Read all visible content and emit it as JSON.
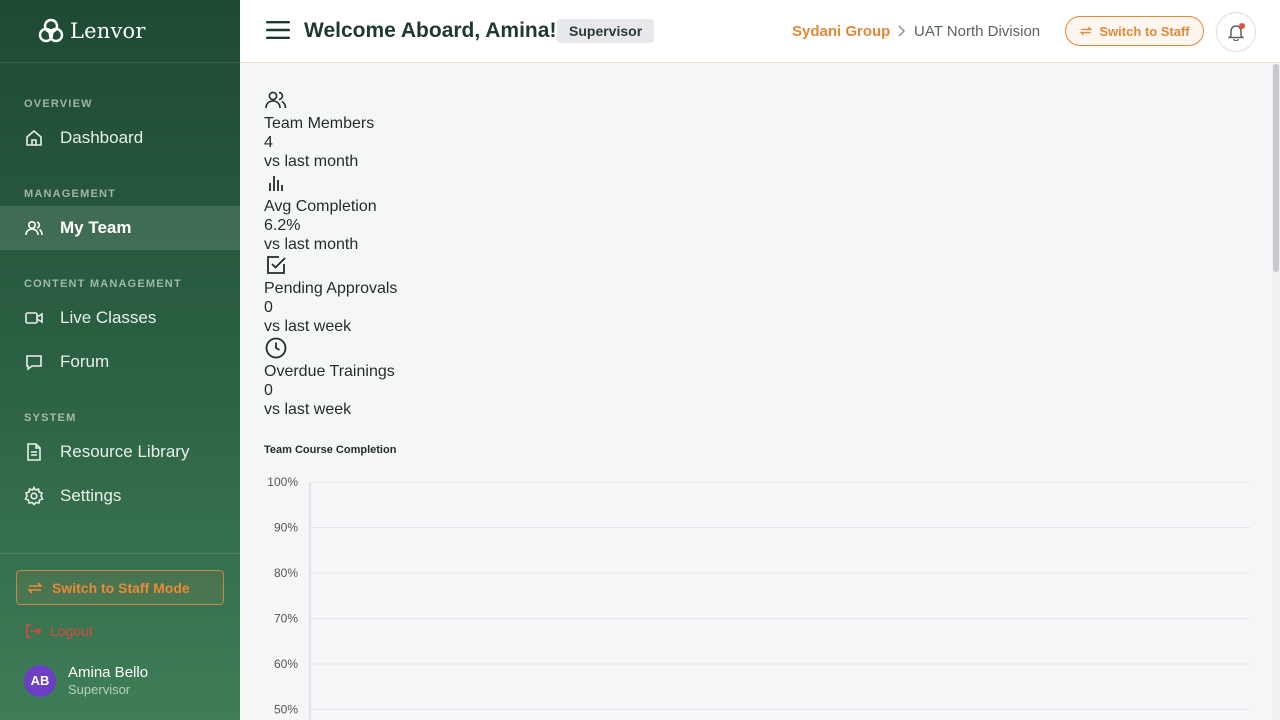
{
  "brand": {
    "name": "Lenvor"
  },
  "sidebar": {
    "sections": [
      {
        "label": "OVERVIEW"
      },
      {
        "label": "MANAGEMENT"
      },
      {
        "label": "CONTENT MANAGEMENT"
      },
      {
        "label": "SYSTEM"
      }
    ],
    "items": [
      {
        "label": "Dashboard",
        "icon": "home-icon"
      },
      {
        "label": "My Team",
        "icon": "users-icon",
        "active": true
      },
      {
        "label": "Live Classes",
        "icon": "video-icon"
      },
      {
        "label": "Forum",
        "icon": "chat-icon"
      },
      {
        "label": "Resource Library",
        "icon": "document-icon"
      },
      {
        "label": "Settings",
        "icon": "gear-icon"
      }
    ],
    "switch_mode_label": "Switch to Staff Mode",
    "logout_label": "Logout",
    "user": {
      "initials": "AB",
      "name": "Amina Bello",
      "role": "Supervisor"
    }
  },
  "header": {
    "welcome": "Welcome Aboard, Amina!",
    "role_badge": "Supervisor",
    "breadcrumb": {
      "org": "Sydani Group",
      "division": "UAT North Division"
    },
    "switch_label": "Switch to Staff"
  },
  "stats": [
    {
      "icon": "users-icon",
      "label": "Team Members",
      "value": "4",
      "compare": "vs last month"
    },
    {
      "icon": "bar-chart-icon",
      "label": "Avg Completion",
      "value": "6.2%",
      "compare": "vs last month"
    },
    {
      "icon": "check-square-icon",
      "label": "Pending Approvals",
      "value": "0",
      "compare": "vs last week"
    },
    {
      "icon": "clock-icon",
      "label": "Overdue Trainings",
      "value": "0",
      "compare": "vs last week"
    }
  ],
  "colors": {
    "accent": "#e0893a",
    "sidebar": "#2a5e41",
    "logout": "#d94a3a",
    "avatar": "#6c3fc4"
  },
  "chart_data": {
    "type": "bar",
    "title": "Team Course Completion",
    "categories": [],
    "values": [],
    "yticks": [
      "100%",
      "90%",
      "80%",
      "70%",
      "60%",
      "50%"
    ],
    "ylim": [
      0,
      100
    ],
    "grid": true
  }
}
